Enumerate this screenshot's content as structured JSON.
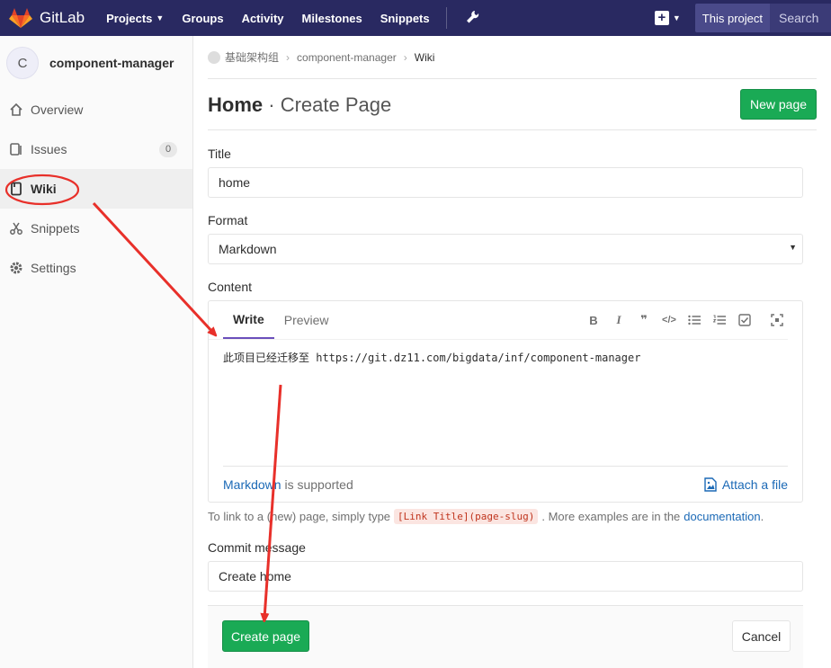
{
  "navbar": {
    "brand": "GitLab",
    "links": [
      "Projects",
      "Groups",
      "Activity",
      "Milestones",
      "Snippets"
    ],
    "scope_button": "This project",
    "search_placeholder": "Search"
  },
  "sidebar": {
    "avatar_letter": "C",
    "project_name": "component-manager",
    "items": [
      {
        "label": "Overview",
        "icon": "home-icon"
      },
      {
        "label": "Issues",
        "icon": "issues-icon",
        "count": "0"
      },
      {
        "label": "Wiki",
        "icon": "book-icon"
      },
      {
        "label": "Snippets",
        "icon": "scissors-icon"
      },
      {
        "label": "Settings",
        "icon": "gear-icon"
      }
    ]
  },
  "breadcrumb": {
    "group": "基础架构组",
    "project": "component-manager",
    "current": "Wiki"
  },
  "header": {
    "title": "Home",
    "separator": "·",
    "subtitle": "Create Page",
    "new_page_button": "New page"
  },
  "form": {
    "title_label": "Title",
    "title_value": "home",
    "format_label": "Format",
    "format_value": "Markdown",
    "content_label": "Content",
    "tabs": [
      "Write",
      "Preview"
    ],
    "toolbar": [
      "bold-icon",
      "italic-icon",
      "quote-icon",
      "code-icon",
      "bullet-list-icon",
      "numbered-list-icon",
      "task-list-icon",
      "fullscreen-icon"
    ],
    "content_text": "此项目已经迁移至 https://git.dz11.com/bigdata/inf/component-manager",
    "markdown_link": "Markdown",
    "markdown_suffix": " is supported",
    "attach_label": "Attach a file",
    "hint_prefix": "To link to a (new) page, simply type",
    "hint_code": "[Link Title](page-slug)",
    "hint_middle": ". More examples are in the",
    "hint_link": "documentation",
    "hint_end": ".",
    "commit_label": "Commit message",
    "commit_value": "Create home",
    "create_button": "Create page",
    "cancel_button": "Cancel"
  },
  "colors": {
    "navbar": "#292961",
    "green": "#1aaa55",
    "annotation": "#e8302a",
    "link": "#1b69b6"
  }
}
